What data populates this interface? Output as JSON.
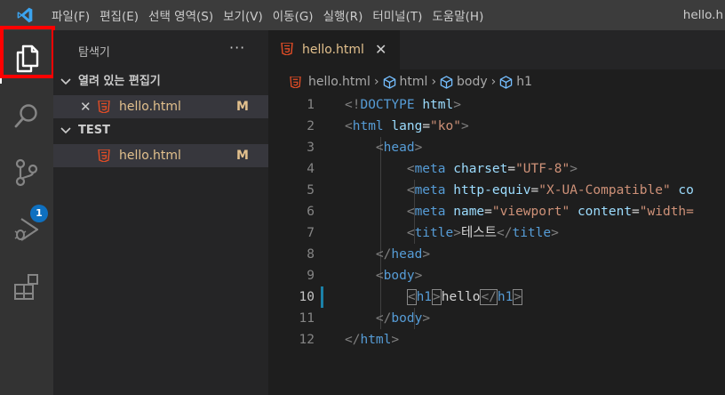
{
  "menu": [
    "파일(F)",
    "편집(E)",
    "선택 영역(S)",
    "보기(V)",
    "이동(G)",
    "실행(R)",
    "터미널(T)",
    "도움말(H)"
  ],
  "window_title": "hello.h",
  "activity": {
    "items": [
      "explorer",
      "search",
      "source-control",
      "run-debug",
      "extensions"
    ],
    "scm_badge": "1"
  },
  "sidebar": {
    "title": "탐색기",
    "more": "···",
    "open_editors": {
      "header": "열려 있는 편집기",
      "item": {
        "name": "hello.html",
        "status": "M"
      }
    },
    "folder": {
      "header": "TEST",
      "item": {
        "name": "hello.html",
        "status": "M"
      }
    }
  },
  "tab": {
    "label": "hello.html"
  },
  "breadcrumb": [
    "hello.html",
    "html",
    "body",
    "h1"
  ],
  "editor": {
    "current_line": 10,
    "line_numbers": [
      "1",
      "2",
      "3",
      "4",
      "5",
      "6",
      "7",
      "8",
      "9",
      "10",
      "11",
      "12"
    ],
    "lines": [
      [
        [
          "punc",
          "<!"
        ],
        [
          "tag",
          "DOCTYPE"
        ],
        [
          "text",
          " "
        ],
        [
          "attr",
          "html"
        ],
        [
          "punc",
          ">"
        ]
      ],
      [
        [
          "punc",
          "<"
        ],
        [
          "tag",
          "html"
        ],
        [
          "text",
          " "
        ],
        [
          "attr",
          "lang"
        ],
        [
          "text",
          "="
        ],
        [
          "str",
          "\"ko\""
        ],
        [
          "punc",
          ">"
        ]
      ],
      [
        [
          "text",
          "    "
        ],
        [
          "punc",
          "<"
        ],
        [
          "tag",
          "head"
        ],
        [
          "punc",
          ">"
        ]
      ],
      [
        [
          "text",
          "        "
        ],
        [
          "punc",
          "<"
        ],
        [
          "tag",
          "meta"
        ],
        [
          "text",
          " "
        ],
        [
          "attr",
          "charset"
        ],
        [
          "text",
          "="
        ],
        [
          "str",
          "\"UTF-8\""
        ],
        [
          "punc",
          ">"
        ]
      ],
      [
        [
          "text",
          "        "
        ],
        [
          "punc",
          "<"
        ],
        [
          "tag",
          "meta"
        ],
        [
          "text",
          " "
        ],
        [
          "attr",
          "http-equiv"
        ],
        [
          "text",
          "="
        ],
        [
          "str",
          "\"X-UA-Compatible\""
        ],
        [
          "text",
          " "
        ],
        [
          "attr",
          "co"
        ]
      ],
      [
        [
          "text",
          "        "
        ],
        [
          "punc",
          "<"
        ],
        [
          "tag",
          "meta"
        ],
        [
          "text",
          " "
        ],
        [
          "attr",
          "name"
        ],
        [
          "text",
          "="
        ],
        [
          "str",
          "\"viewport\""
        ],
        [
          "text",
          " "
        ],
        [
          "attr",
          "content"
        ],
        [
          "text",
          "="
        ],
        [
          "str",
          "\"width="
        ]
      ],
      [
        [
          "text",
          "        "
        ],
        [
          "punc",
          "<"
        ],
        [
          "tag",
          "title"
        ],
        [
          "punc",
          ">"
        ],
        [
          "text",
          "테스트"
        ],
        [
          "punc",
          "</"
        ],
        [
          "tag",
          "title"
        ],
        [
          "punc",
          ">"
        ]
      ],
      [
        [
          "text",
          "    "
        ],
        [
          "punc",
          "</"
        ],
        [
          "tag",
          "head"
        ],
        [
          "punc",
          ">"
        ]
      ],
      [
        [
          "text",
          "    "
        ],
        [
          "punc",
          "<"
        ],
        [
          "tag",
          "body"
        ],
        [
          "punc",
          ">"
        ]
      ],
      [
        [
          "text",
          "        "
        ],
        [
          "punc",
          "<"
        ],
        [
          "tag",
          "h1"
        ],
        [
          "punc",
          ">"
        ],
        [
          "text",
          "hello"
        ],
        [
          "punc",
          "</"
        ],
        [
          "tag",
          "h1"
        ],
        [
          "punc",
          ">"
        ]
      ],
      [
        [
          "text",
          "    "
        ],
        [
          "punc",
          "</"
        ],
        [
          "tag",
          "body"
        ],
        [
          "punc",
          ">"
        ]
      ],
      [
        [
          "punc",
          "</"
        ],
        [
          "tag",
          "html"
        ],
        [
          "punc",
          ">"
        ]
      ]
    ]
  },
  "colors": {
    "highlight": "#ff0000",
    "modified": "#e2c08d",
    "badge": "#0e70c0",
    "html_icon": "#e44d26"
  }
}
